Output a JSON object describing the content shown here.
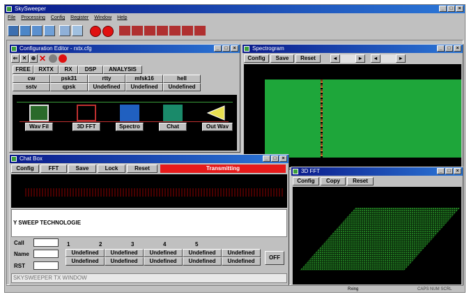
{
  "app": {
    "title": "SkySweeper",
    "menu": [
      "File",
      "Processing",
      "Config",
      "Register",
      "Window",
      "Help"
    ],
    "toolbar_icons": [
      "open-icon",
      "save-icon",
      "print-icon",
      "filter-icon",
      "tool-icon",
      "record-red-icon",
      "stop-red-icon",
      "grid-icon",
      "grid-icon",
      "grid-icon",
      "grid-icon",
      "grid-icon",
      "grid-icon",
      "grid-icon"
    ],
    "status": {
      "center": "Rxing",
      "right": "CAPS NUM SCRL"
    }
  },
  "config_editor": {
    "title": "Configuration Editor - rxtx.cfg",
    "tabs": [
      "FREE",
      "RXTX",
      "RX",
      "DSP",
      "ANALYSIS"
    ],
    "grid_row1": [
      "cw",
      "psk31",
      "rtty",
      "mfsk16",
      "hell"
    ],
    "grid_row2": [
      "sstv",
      "qpsk",
      "Undefined",
      "Undefined",
      "Undefined"
    ],
    "modules": [
      "Wav Fil",
      "3D FFT",
      "Spectro",
      "Chat",
      "Out Wav"
    ]
  },
  "spectrogram": {
    "title": "Spectrogram",
    "buttons": [
      "Config",
      "Save",
      "Reset"
    ],
    "colors": {
      "field": "#1ea63a",
      "line": "#7a3a1a"
    }
  },
  "chat": {
    "title": "Chat Box",
    "buttons": [
      "Config",
      "FFT",
      "Save",
      "Lock",
      "Reset"
    ],
    "status": "Transmitting",
    "text": "Y SWEEP TECHNOLOGIE",
    "labels": [
      "Call",
      "Name",
      "RST"
    ],
    "macro_nums": [
      "1",
      "2",
      "3",
      "4",
      "5"
    ],
    "macro_row1": [
      "Undefined",
      "Undefined",
      "Undefined",
      "Undefined",
      "Undefined"
    ],
    "macro_row2": [
      "Undefined",
      "Undefined",
      "Undefined",
      "Undefined",
      "Undefined"
    ],
    "off_label": "OFF",
    "tx_text": "SKYSWEEPER TX WINDOW",
    "colors": {
      "status_bg": "#e61a1a"
    }
  },
  "fft3d": {
    "title": "3D FFT",
    "buttons": [
      "Config",
      "Copy",
      "Reset"
    ]
  }
}
